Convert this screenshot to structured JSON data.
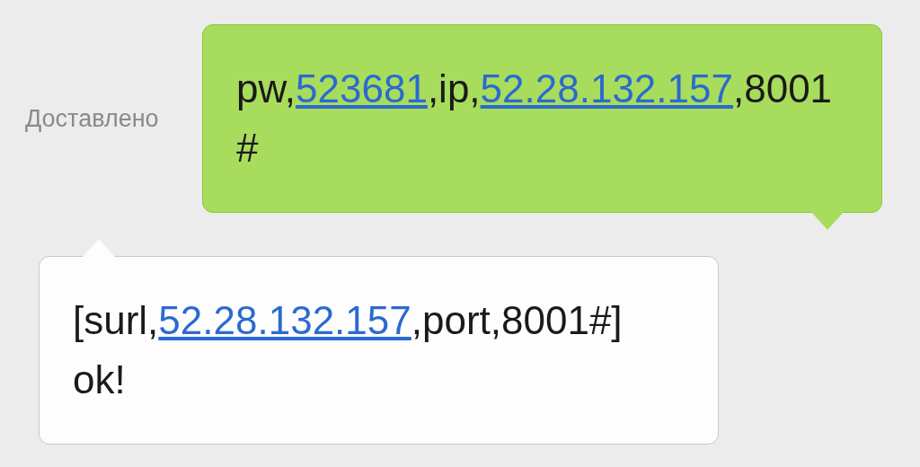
{
  "messages": [
    {
      "kind": "sent",
      "status": "Доставлено",
      "lines": [
        [
          {
            "kind": "text",
            "text": "pw,"
          },
          {
            "kind": "link",
            "text": "523681"
          },
          {
            "kind": "text",
            "text": ",ip,"
          },
          {
            "kind": "link",
            "text": "52.28.132.157"
          },
          {
            "kind": "text",
            "text": ",8001"
          }
        ],
        [
          {
            "kind": "text",
            "text": "#"
          }
        ]
      ]
    },
    {
      "kind": "received",
      "lines": [
        [
          {
            "kind": "text",
            "text": "[surl,"
          },
          {
            "kind": "link",
            "text": "52.28.132.157"
          },
          {
            "kind": "text",
            "text": ",port,8001#]"
          }
        ],
        [
          {
            "kind": "text",
            "text": "ok!"
          }
        ]
      ]
    }
  ]
}
